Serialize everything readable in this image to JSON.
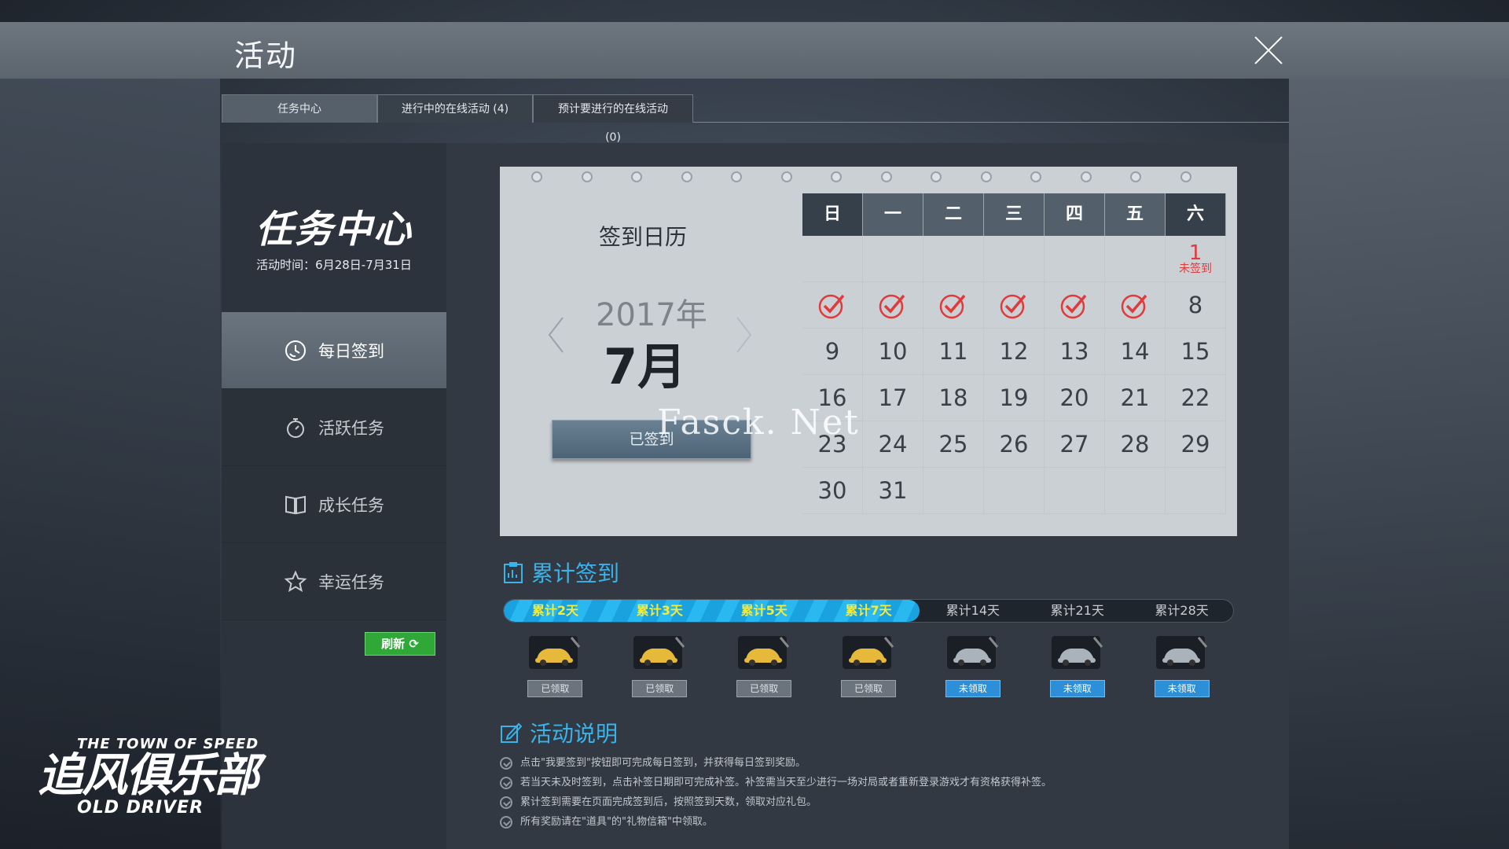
{
  "window": {
    "title": "活动",
    "close_label": "关闭"
  },
  "tabs": [
    {
      "label": "任务中心",
      "active": true
    },
    {
      "label": "进行中的在线活动 (4)",
      "active": false
    },
    {
      "label": "预计要进行的在线活动(0)",
      "active": false
    }
  ],
  "brand": {
    "title": "任务中心",
    "period": "活动时间：6月28日-7月31日"
  },
  "menu": [
    {
      "label": "每日签到",
      "icon": "clock-icon",
      "active": true
    },
    {
      "label": "活跃任务",
      "icon": "stopwatch-icon",
      "active": false
    },
    {
      "label": "成长任务",
      "icon": "book-icon",
      "active": false
    },
    {
      "label": "幸运任务",
      "icon": "star-icon",
      "active": false
    }
  ],
  "refresh_label": "刷新",
  "calendar": {
    "title": "签到日历",
    "year": "2017年",
    "month": "7月",
    "signed_button": "已签到",
    "weekdays": [
      "日",
      "一",
      "二",
      "三",
      "四",
      "五",
      "六"
    ],
    "unsigned_label": "未签到",
    "weeks": [
      [
        "",
        "",
        "",
        "",
        "",
        "",
        "1"
      ],
      [
        "2",
        "3",
        "4",
        "5",
        "6",
        "7",
        "8"
      ],
      [
        "9",
        "10",
        "11",
        "12",
        "13",
        "14",
        "15"
      ],
      [
        "16",
        "17",
        "18",
        "19",
        "20",
        "21",
        "22"
      ],
      [
        "23",
        "24",
        "25",
        "26",
        "27",
        "28",
        "29"
      ],
      [
        "30",
        "31",
        "",
        "",
        "",
        "",
        ""
      ]
    ],
    "signed_days": [
      "2",
      "3",
      "4",
      "5",
      "6",
      "7"
    ],
    "unsigned_days": [
      "1"
    ]
  },
  "watermark": "Fasck. Net",
  "cumulative": {
    "title": "累计签到",
    "progress_fraction": 0.57,
    "milestones": [
      {
        "label": "累计2天",
        "done": true,
        "claim": "已领取"
      },
      {
        "label": "累计3天",
        "done": true,
        "claim": "已领取"
      },
      {
        "label": "累计5天",
        "done": true,
        "claim": "已领取"
      },
      {
        "label": "累计7天",
        "done": true,
        "claim": "已领取"
      },
      {
        "label": "累计14天",
        "done": false,
        "claim": "未领取"
      },
      {
        "label": "累计21天",
        "done": false,
        "claim": "未领取"
      },
      {
        "label": "累计28天",
        "done": false,
        "claim": "未领取"
      }
    ]
  },
  "description": {
    "title": "活动说明",
    "lines": [
      "点击\"我要签到\"按钮即可完成每日签到，并获得每日签到奖励。",
      "若当天未及时签到，点击补签日期即可完成补签。补签需当天至少进行一场对局或者重新登录游戏才有资格获得补签。",
      "累计签到需要在页面完成签到后，按照签到天数，领取对应礼包。",
      "所有奖励请在\"道具\"的\"礼物信箱\"中领取。"
    ]
  },
  "logo": {
    "top": "THE TOWN OF SPEED",
    "main": "追风俱乐部",
    "bottom": "OLD DRIVER"
  },
  "colors": {
    "accent_blue": "#3ab3ea",
    "gold": "#f4ec3a",
    "green": "#2fa838",
    "red": "#e03a3a"
  }
}
